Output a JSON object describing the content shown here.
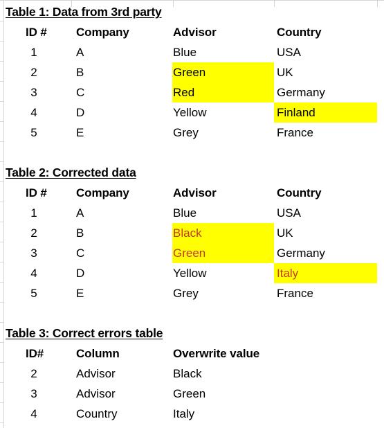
{
  "theme": {
    "highlight_color": "#ffff00",
    "corrected_text_color": "#c0392b",
    "text_color": "#000000",
    "background": "#ffffff",
    "gridline_color": "#d4d4d4"
  },
  "tables": [
    {
      "id": "table-1",
      "title": "Table 1: Data from 3rd party",
      "headers": {
        "id": "ID #",
        "company": "Company",
        "advisor": "Advisor",
        "country": "Country"
      },
      "rows": [
        {
          "id": "1",
          "company": "A",
          "advisor": "Blue",
          "country": "USA"
        },
        {
          "id": "2",
          "company": "B",
          "advisor": "Green",
          "country": "UK"
        },
        {
          "id": "3",
          "company": "C",
          "advisor": "Red",
          "country": "Germany"
        },
        {
          "id": "4",
          "company": "D",
          "advisor": "Yellow",
          "country": "Finland"
        },
        {
          "id": "5",
          "company": "E",
          "advisor": "Grey",
          "country": "France"
        }
      ]
    },
    {
      "id": "table-2",
      "title": "Table 2: Corrected data",
      "headers": {
        "id": "ID #",
        "company": "Company",
        "advisor": "Advisor",
        "country": "Country"
      },
      "rows": [
        {
          "id": "1",
          "company": "A",
          "advisor": "Blue",
          "country": "USA"
        },
        {
          "id": "2",
          "company": "B",
          "advisor": "Black",
          "country": "UK"
        },
        {
          "id": "3",
          "company": "C",
          "advisor": "Green",
          "country": "Germany"
        },
        {
          "id": "4",
          "company": "D",
          "advisor": "Yellow",
          "country": "Italy"
        },
        {
          "id": "5",
          "company": "E",
          "advisor": "Grey",
          "country": "France"
        }
      ]
    },
    {
      "id": "table-3",
      "title": "Table 3: Correct errors table",
      "headers": {
        "id": "ID#",
        "column": "Column",
        "value": "Overwrite value"
      },
      "rows": [
        {
          "id": "2",
          "column": "Advisor",
          "value": "Black"
        },
        {
          "id": "3",
          "column": "Advisor",
          "value": "Green"
        },
        {
          "id": "4",
          "column": "Country",
          "value": "Italy"
        }
      ]
    }
  ]
}
